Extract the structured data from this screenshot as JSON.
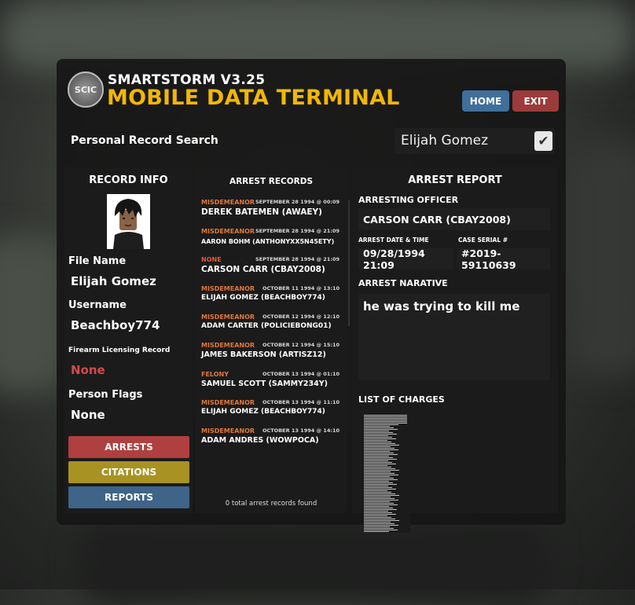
{
  "header": {
    "app_name": "SMARTSTORM V3.25",
    "app_title": "MOBILE DATA TERMINAL",
    "seal_text": "SCIC",
    "home_label": "HOME",
    "exit_label": "EXIT"
  },
  "search": {
    "label": "Personal Record Search",
    "value": "Elijah Gomez",
    "checked": true
  },
  "record_info": {
    "heading": "RECORD INFO",
    "file_name_label": "File Name",
    "file_name": "Elijah Gomez",
    "username_label": "Username",
    "username": "Beachboy774",
    "firearm_label": "Firearm Licensing Record",
    "firearm_value": "None",
    "flags_label": "Person Flags",
    "flags_value": "None",
    "buttons": {
      "arrests": "ARRESTS",
      "citations": "CITATIONS",
      "reports": "REPORTS"
    },
    "button_colors": {
      "arrests": "#b0403f",
      "citations": "#a89224",
      "reports": "#3e6488"
    }
  },
  "arrest_records": {
    "heading": "ARREST RECORDS",
    "records": [
      {
        "type": "MISDEMEANOR",
        "date": "SEPTEMBER 28 1994 @ 00:09",
        "name": "DEREK BATEMEN (AWAEY)"
      },
      {
        "type": "MISDEMEANOR",
        "date": "SEPTEMBER 28 1994 @ 21:09",
        "name": "AARON BOHM (ANTHONYXX5N45ETY)"
      },
      {
        "type": "NONE",
        "date": "SEPTEMBER 28 1994 @ 21:09",
        "name": "CARSON CARR (CBAY2008)"
      },
      {
        "type": "MISDEMEANOR",
        "date": "OCTOBER 11 1994 @ 13:10",
        "name": "ELIJAH GOMEZ (BEACHBOY774)"
      },
      {
        "type": "MISDEMEANOR",
        "date": "OCTOBER 12 1994 @ 12:10",
        "name": "ADAM CARTER (POLICIEBONG01)"
      },
      {
        "type": "MISDEMEANOR",
        "date": "OCTOBER 12 1994 @ 15:10",
        "name": "JAMES BAKERSON (ARTISZ12)"
      },
      {
        "type": "FELONY",
        "date": "OCTOBER 13 1994 @ 01:10",
        "name": "SAMUEL SCOTT (SAMMY234Y)"
      },
      {
        "type": "MISDEMEANOR",
        "date": "OCTOBER 13 1994 @ 11:10",
        "name": "ELIJAH GOMEZ (BEACHBOY774)"
      },
      {
        "type": "MISDEMEANOR",
        "date": "OCTOBER 13 1994 @ 14:10",
        "name": "ADAM ANDRES (WOWPOCA)"
      }
    ],
    "count_text": "0 total arrest records found"
  },
  "arrest_report": {
    "heading": "ARREST REPORT",
    "officer_label": "ARRESTING OFFICER",
    "officer": "CARSON CARR (CBAY2008)",
    "date_label": "ARREST DATE & TIME",
    "date_value": "09/28/1994 21:09",
    "serial_label": "CASE SERIAL #",
    "serial_value": "#2019-59110639",
    "narrative_label": "ARREST NARATIVE",
    "narrative": "he was trying to kill me",
    "charges_label": "LIST OF CHARGES"
  },
  "colors": {
    "accent_yellow": "#f2b705",
    "misdemeanor": "#e0783c",
    "none_red": "#d14b4b"
  }
}
